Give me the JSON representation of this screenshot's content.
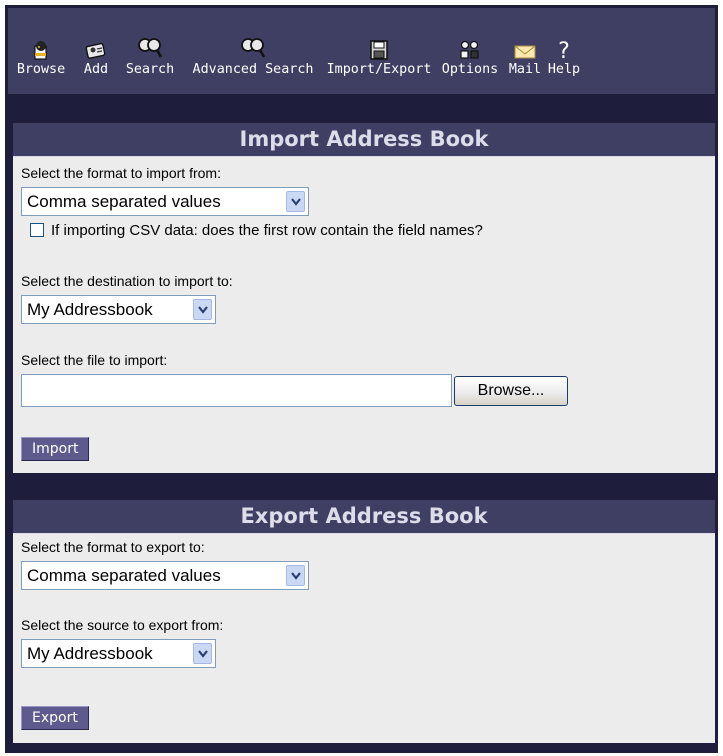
{
  "toolbar": {
    "items": [
      {
        "label": "Browse",
        "icon": "browse-icon"
      },
      {
        "label": "Add",
        "icon": "add-icon"
      },
      {
        "label": "Search",
        "icon": "search-icon"
      },
      {
        "label": "Advanced Search",
        "icon": "advanced-search-icon"
      },
      {
        "label": "Import/Export",
        "icon": "floppy-disk-icon"
      },
      {
        "label": "Options",
        "icon": "options-icon"
      },
      {
        "label": "Mail",
        "icon": "envelope-icon"
      },
      {
        "label": "Help",
        "icon": "question-mark-icon"
      }
    ]
  },
  "import": {
    "title": "Import Address Book",
    "format_label": "Select the format to import from:",
    "format_value": "Comma separated values",
    "csv_header_label": "If importing CSV data: does the first row contain the field names?",
    "csv_header_checked": false,
    "destination_label": "Select the destination to import to:",
    "destination_value": "My Addressbook",
    "file_label": "Select the file to import:",
    "file_value": "",
    "browse_label": "Browse...",
    "submit_label": "Import"
  },
  "export": {
    "title": "Export Address Book",
    "format_label": "Select the format to export to:",
    "format_value": "Comma separated values",
    "source_label": "Select the source to export from:",
    "source_value": "My Addressbook",
    "submit_label": "Export"
  },
  "colors": {
    "frame": "#1e1e3c",
    "header": "#3f3f63",
    "panel": "#ececec",
    "button": "#5e5a8e"
  }
}
